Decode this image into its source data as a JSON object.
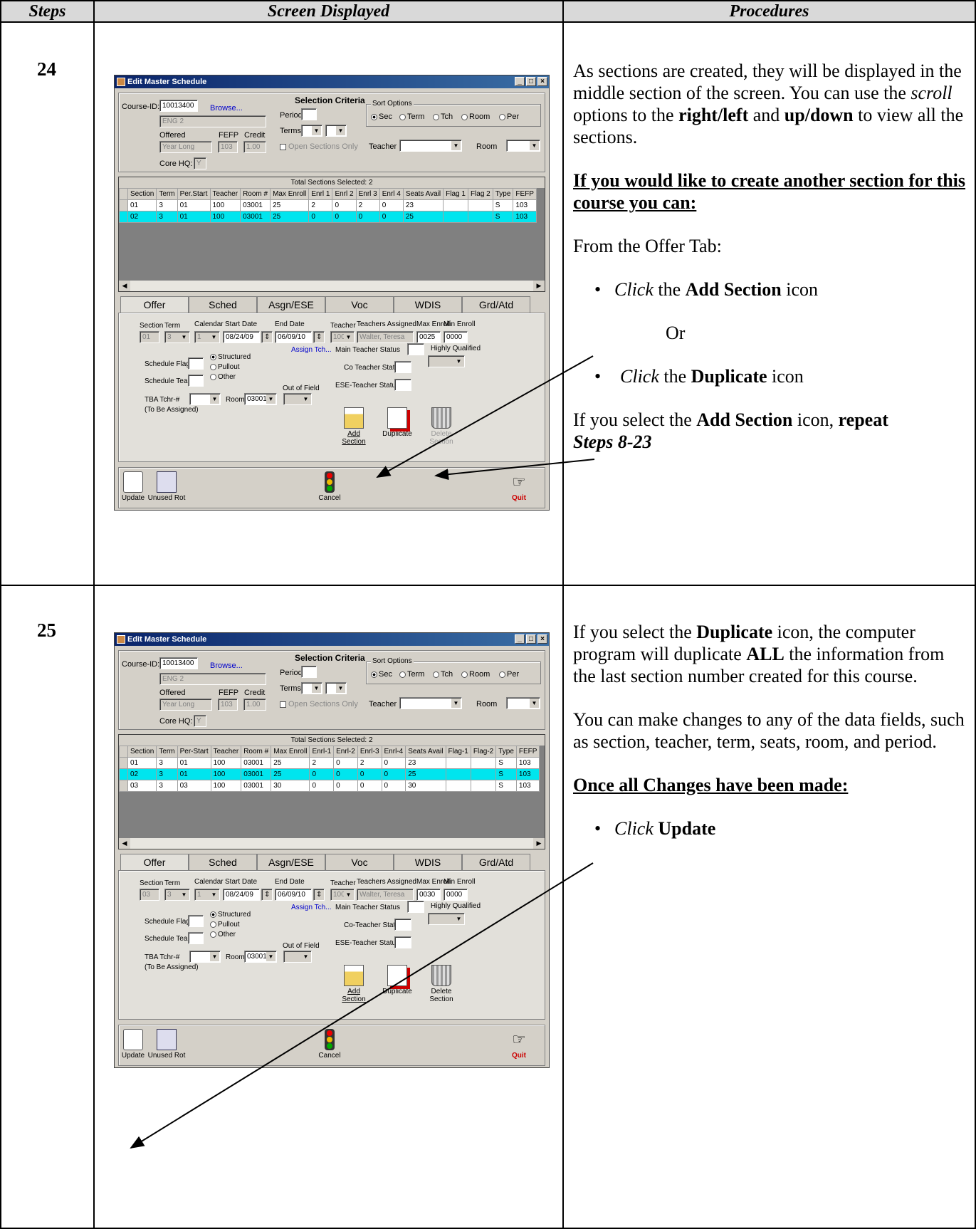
{
  "header": {
    "steps": "Steps",
    "screen": "Screen Displayed",
    "procedures": "Procedures"
  },
  "steps": [
    {
      "number": "24",
      "procedures": {
        "p1_a": "As sections are created, they will be displayed in the middle section of the screen. You can use the ",
        "p1_scroll": "scroll",
        "p1_b": " options to the ",
        "p1_rl": "right/left",
        "p1_c": " and ",
        "p1_ud": "up/down",
        "p1_d": " to view all the sections.",
        "heading": "If you would like to create another section for this course you can:",
        "from": "From the Offer Tab:",
        "b1_click": "Click",
        "b1_the": " the ",
        "b1_bold": "Add Section",
        "b1_end": " icon",
        "or": "Or",
        "b2_click": "Click",
        "b2_the": " the ",
        "b2_bold": "Duplicate",
        "b2_end": " icon",
        "p_last_a": "If you select the ",
        "p_last_bold": "Add Section",
        "p_last_b": " icon, ",
        "p_last_repeat": "repeat",
        "p_last_steps": "Steps 8-23"
      }
    },
    {
      "number": "25",
      "procedures": {
        "p1_a": "If you select the ",
        "p1_bold": "Duplicate",
        "p1_b": " icon, the computer program will duplicate ",
        "p1_all": "ALL",
        "p1_c": " the information from the last section number created for this course.",
        "p2": "You can make changes to any of the data fields, such as section, teacher, term, seats, room, and period.",
        "heading": "Once all Changes have been made:",
        "b1_click": "Click",
        "b1_bold": "Update"
      }
    }
  ],
  "window": {
    "title": "Edit Master Schedule",
    "course_id_label": "Course-ID:",
    "course_id": "10013400",
    "browse": "Browse...",
    "course_name": "ENG 2",
    "offered_label": "Offered",
    "offered": "Year Long",
    "fefp_label": "FEFP",
    "fefp": "103",
    "credit_label": "Credit",
    "credit": "1.00",
    "core_hq_label": "Core HQ:",
    "core_hq": "Y",
    "selection_criteria": "Selection Criteria",
    "period_label": "Period",
    "terms_label": "Terms",
    "open_sections": "Open Sections Only",
    "sort_options": "Sort Options",
    "sort": [
      "Sec",
      "Term",
      "Tch",
      "Room",
      "Per"
    ],
    "teacher_label": "Teacher",
    "room_label": "Room",
    "total_sections_1": "Total Sections Selected: 2",
    "total_sections_2": "Total Sections Selected: 2",
    "grid_columns_1": [
      "Section",
      "Term",
      "Per.Start",
      "Teacher",
      "Room #",
      "Max Enroll",
      "Enrl 1",
      "Enrl 2",
      "Enrl 3",
      "Enrl 4",
      "Seats Avail",
      "Flag 1",
      "Flag 2",
      "Type",
      "FEFP"
    ],
    "grid_columns_2": [
      "Section",
      "Term",
      "Per-Start",
      "Teacher",
      "Room #",
      "Max Enroll",
      "Enrl-1",
      "Enrl-2",
      "Enrl-3",
      "Enrl-4",
      "Seats Avail",
      "Flag-1",
      "Flag-2",
      "Type",
      "FEFP"
    ],
    "rows_1": [
      [
        "01",
        "3",
        "01",
        "100",
        "03001",
        "25",
        "2",
        "0",
        "2",
        "0",
        "23",
        "",
        "",
        "S",
        "103"
      ],
      [
        "02",
        "3",
        "01",
        "100",
        "03001",
        "25",
        "0",
        "0",
        "0",
        "0",
        "25",
        "",
        "",
        "S",
        "103"
      ]
    ],
    "rows_2": [
      [
        "01",
        "3",
        "01",
        "100",
        "03001",
        "25",
        "2",
        "0",
        "2",
        "0",
        "23",
        "",
        "",
        "S",
        "103"
      ],
      [
        "02",
        "3",
        "01",
        "100",
        "03001",
        "25",
        "0",
        "0",
        "0",
        "0",
        "25",
        "",
        "",
        "S",
        "103"
      ],
      [
        "03",
        "3",
        "03",
        "100",
        "03001",
        "30",
        "0",
        "0",
        "0",
        "0",
        "30",
        "",
        "",
        "S",
        "103"
      ]
    ],
    "tabs": [
      "Offer",
      "Sched",
      "Asgn/ESE",
      "Voc",
      "WDIS",
      "Grd/Atd"
    ],
    "offer": {
      "section_label": "Section",
      "term_label": "Term",
      "calendar_label": "Calendar",
      "start_date_label": "Start Date",
      "end_date_label": "End Date",
      "teacher_label": "Teacher",
      "teachers_assigned_label": "Teachers Assigned",
      "max_enroll_label": "Max Enroll",
      "min_enroll_label": "Min Enroll",
      "term": "3",
      "calendar": "1",
      "start_date": "08/24/09",
      "end_date": "06/09/10",
      "teacher": "100",
      "teachers_assigned": "Walter, Teresa",
      "min_enroll": "0000",
      "assign_tch": "Assign Tch...",
      "main_teacher_status": "Main Teacher Status",
      "co_teacher_status_1": "Co Teacher Status",
      "co_teacher_status_2": "Co-Teacher Status",
      "ese_teacher_status": "ESE-Teacher Status",
      "highly_qualified": "Highly Qualified",
      "schedule_flag": "Schedule Flag",
      "schedule_team": "Schedule Team",
      "structured": "Structured",
      "pullout": "Pullout",
      "other": "Other",
      "out_of_field": "Out of Field",
      "tba_tchr": "TBA Tchr-#",
      "to_be_assigned": "(To Be Assigned)",
      "room_label": "Room",
      "room": "03001",
      "add_section": "Add Section",
      "duplicate": "Duplicate",
      "delete_section": "Delete Section"
    },
    "offer_1": {
      "section": "01",
      "max_enroll": "0025"
    },
    "offer_2": {
      "section": "03",
      "max_enroll": "0030"
    },
    "bottom": {
      "update": "Update",
      "unused_rot": "Unused Rot",
      "cancel": "Cancel",
      "quit": "Quit"
    }
  }
}
